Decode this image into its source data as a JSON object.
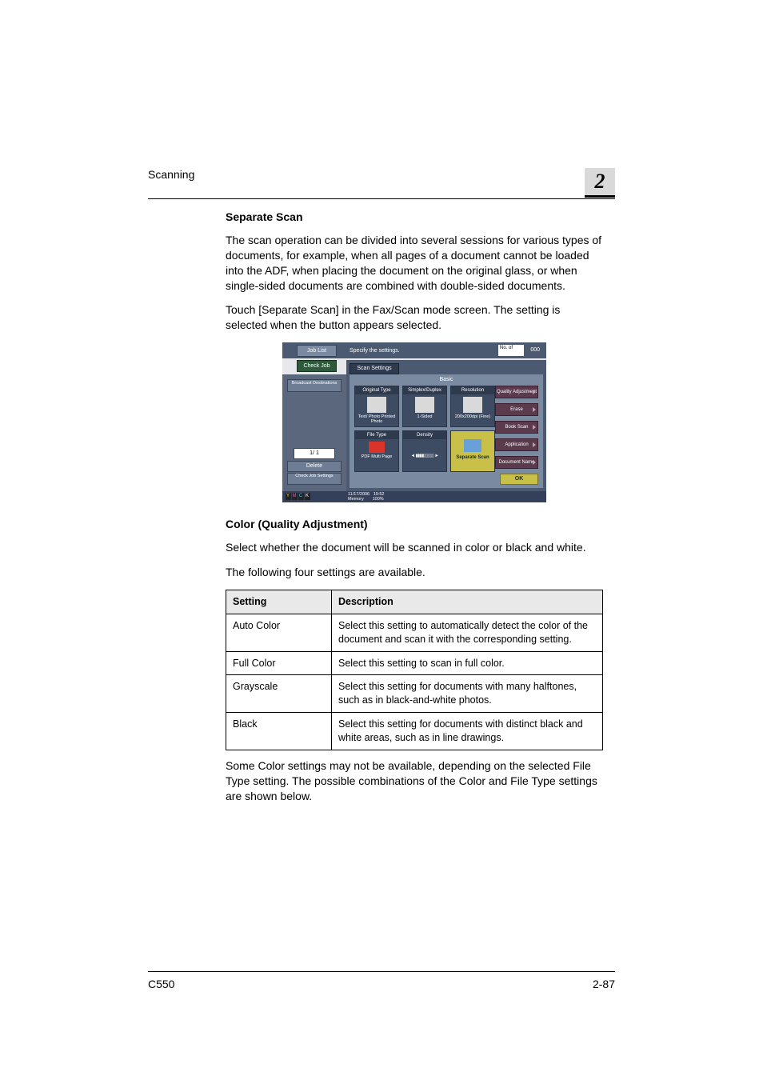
{
  "header": {
    "running": "Scanning",
    "chapter": "2"
  },
  "footer": {
    "model": "C550",
    "page": "2-87"
  },
  "section1": {
    "title": "Separate Scan",
    "p1": "The scan operation can be divided into several sessions for various types of documents, for example, when all pages of a document cannot be loaded into the ADF, when placing the document on the original glass, or when single-sided documents are combined with double-sided documents.",
    "p2": "Touch [Separate Scan] in the Fax/Scan mode screen. The setting is selected when the button appears selected."
  },
  "section2": {
    "title": "Color (Quality Adjustment)",
    "p1": "Select whether the document will be scanned in color or black and white.",
    "p2": "The following four settings are available.",
    "p3": "Some Color settings may not be available, depending on the selected File Type setting. The possible combinations of the Color and File Type settings are shown below."
  },
  "table": {
    "headers": [
      "Setting",
      "Description"
    ],
    "rows": [
      [
        "Auto Color",
        "Select this setting to automatically detect the color of the document and scan it with the corresponding setting."
      ],
      [
        "Full Color",
        "Select this setting to scan in full color."
      ],
      [
        "Grayscale",
        "Select this setting for documents with many halftones, such as in black-and-white photos."
      ],
      [
        "Black",
        "Select this setting for documents with distinct black and white areas, such as in line drawings."
      ]
    ]
  },
  "shot": {
    "job_list": "Job List",
    "check_job": "Check Job",
    "specify": "Specify the settings.",
    "no_of": "No. of",
    "zeros": "000",
    "scan_settings": "Scan Settings",
    "basic": "Basic",
    "bcast": "Broadcast Destinations",
    "pages": "1/   1",
    "delete": "Delete",
    "check_setting": "Check Job Settings",
    "cells": {
      "c1h": "Original Type",
      "c1c": "Text/ Photo Printed Photo",
      "c2h": "Simplex/Duplex",
      "c2c": "1-Sided",
      "c3h": "Resolution",
      "c3c": "200x200dpi (Fine)",
      "c4h": "File Type",
      "c4c": "PDF Multi Page",
      "c5h": "Density",
      "c5c": "◄ ▮▮▮▮▯▯▯▯▯ ►",
      "c6c": "Separate Scan"
    },
    "side": [
      "Quality Adjustment",
      "Erase",
      "Book Scan",
      "Application",
      "Document Name"
    ],
    "ok": "OK",
    "date": "11/17/2006",
    "time": "19:52",
    "mem": "Memory",
    "mempct": "100%"
  }
}
